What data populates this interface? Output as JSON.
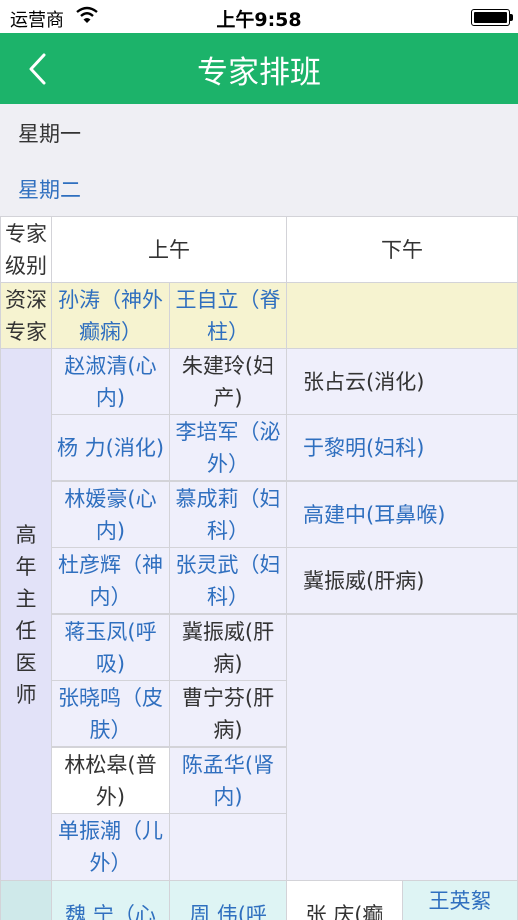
{
  "status": {
    "carrier": "运营商",
    "time": "上午9:58"
  },
  "nav": {
    "title": "专家排班"
  },
  "days": [
    "星期一",
    "星期二"
  ],
  "table": {
    "header": {
      "level": "专家级别",
      "am": "上午",
      "pm": "下午"
    },
    "senior": {
      "label": "资深专家",
      "am": [
        "孙涛（神外癫痫）",
        "王自立（脊柱）"
      ]
    },
    "senior_title": {
      "label": [
        "高",
        "年",
        "主",
        "任",
        "医",
        "师"
      ],
      "am_rows": [
        [
          "赵淑清(心内)",
          "朱建玲(妇产)"
        ],
        [
          "杨 力(消化)",
          "李培军（泌外）"
        ],
        [
          "林媛豪(心内)",
          "慕成莉（妇科）"
        ],
        [
          "杜彦辉（神内）",
          "张灵武（妇科）"
        ],
        [
          "蒋玉凤(呼吸)",
          "冀振威(肝病)"
        ],
        [
          "张晓鸣（皮肤）",
          "曹宁芬(肝病)"
        ],
        [
          "林松皋(普外)",
          "陈孟华(肾内)"
        ],
        [
          "单振潮（儿外）",
          ""
        ]
      ],
      "pm_rows": [
        "张占云(消化)",
        "于黎明(妇科)",
        "高建中(耳鼻喉)",
        "冀振威(肝病)"
      ]
    },
    "partial": {
      "am": [
        "魏 宁（心",
        "周 伟(呼"
      ],
      "pm": [
        "张 庆(癫",
        "王英絮"
      ]
    }
  }
}
